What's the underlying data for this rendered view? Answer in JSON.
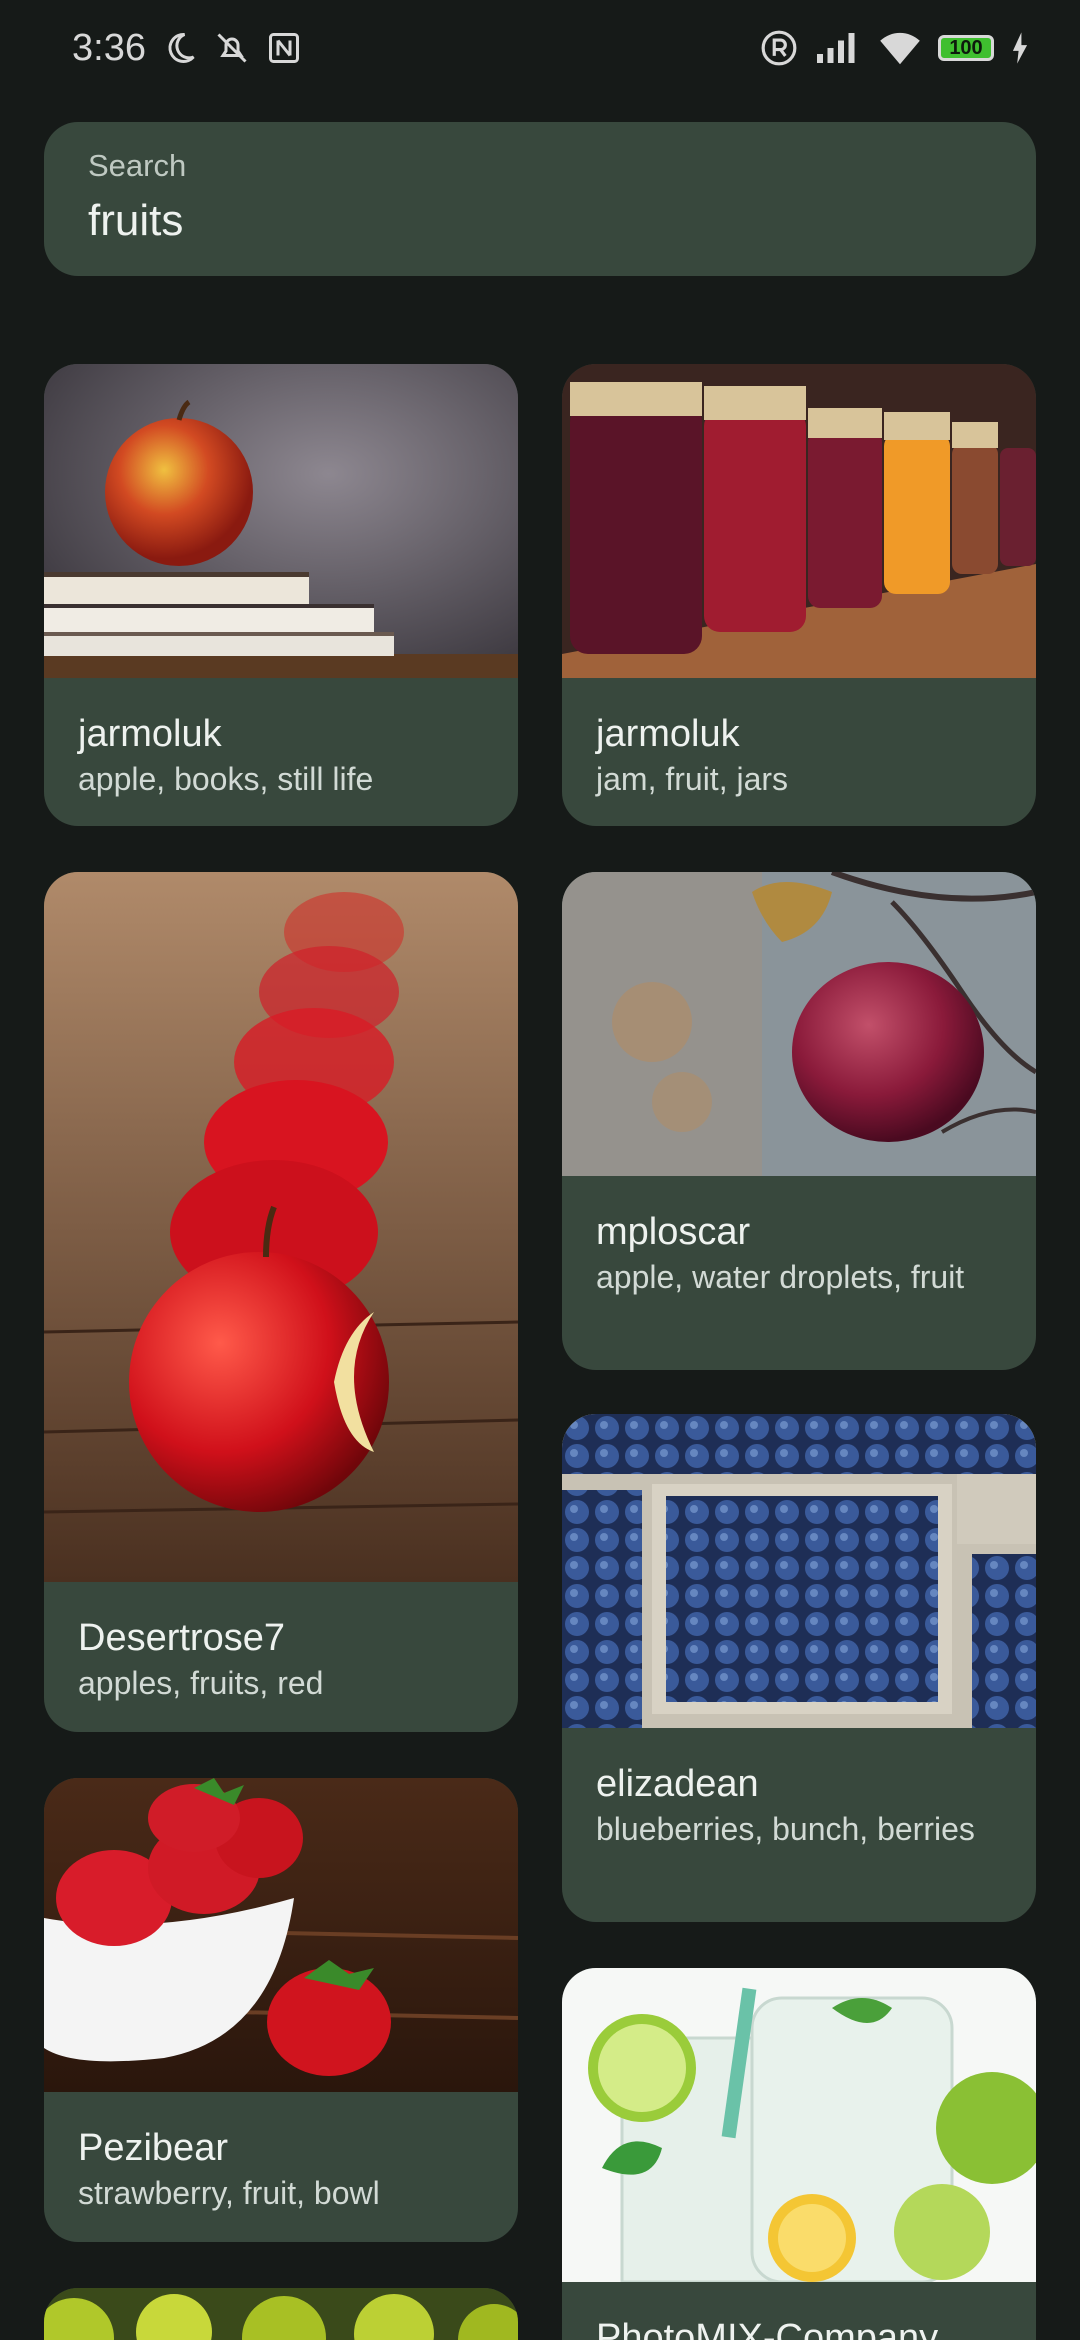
{
  "status_bar": {
    "time": "3:36",
    "battery": "100",
    "icons": [
      "moon-icon",
      "bell-off-icon",
      "nfc-icon",
      "registered-icon",
      "signal-icon",
      "wifi-icon",
      "battery-icon",
      "charging-icon"
    ]
  },
  "search": {
    "label": "Search",
    "value": "fruits"
  },
  "cards": [
    {
      "author": "jarmoluk",
      "tags": "apple, books, still life"
    },
    {
      "author": "jarmoluk",
      "tags": "jam, fruit, jars"
    },
    {
      "author": "Desertrose7",
      "tags": "apples, fruits, red"
    },
    {
      "author": "mploscar",
      "tags": "apple, water droplets, fruit"
    },
    {
      "author": "elizadean",
      "tags": "blueberries, bunch, berries"
    },
    {
      "author": "Pezibear",
      "tags": "strawberry, fruit, bowl"
    },
    {
      "author": "PhotoMIX-Company",
      "tags": ""
    }
  ],
  "colors": {
    "background": "#161a18",
    "card": "#38483d",
    "accent_battery": "#3fbf2f"
  }
}
